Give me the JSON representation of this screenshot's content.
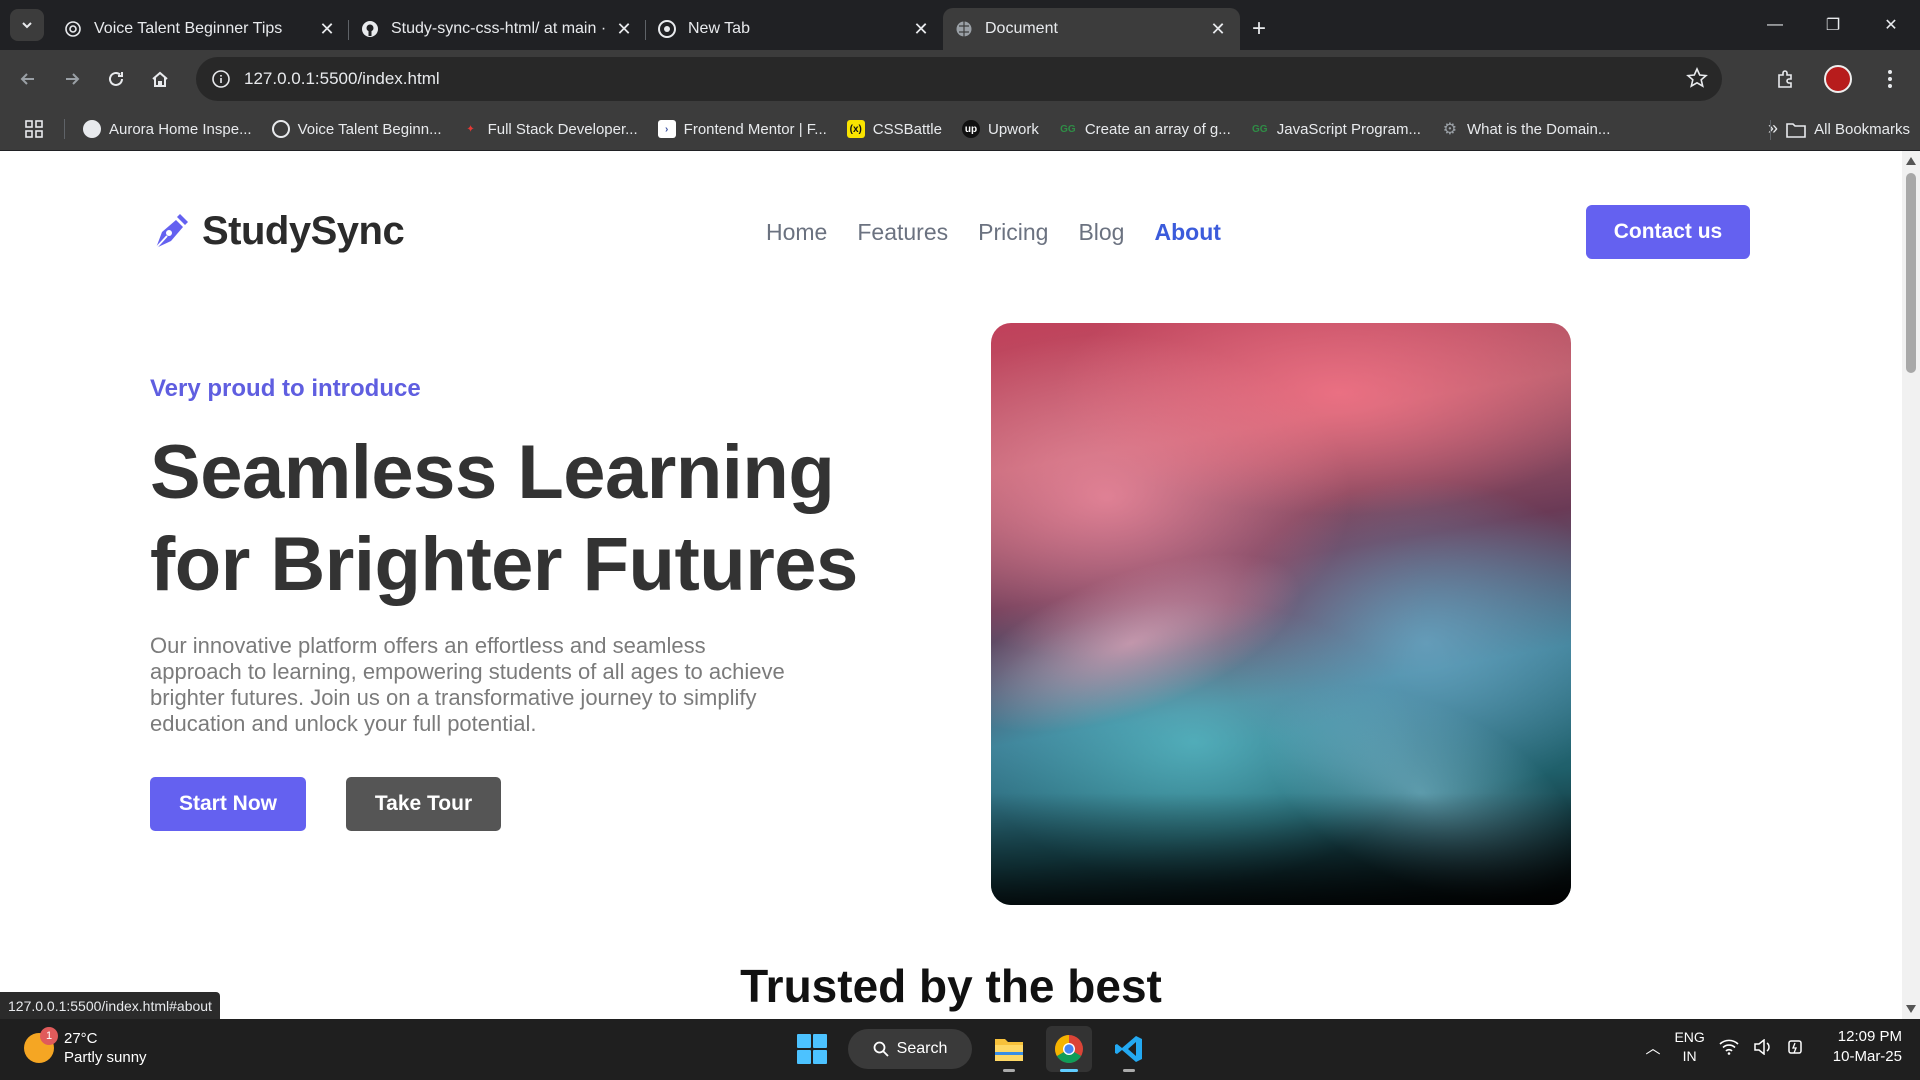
{
  "browser": {
    "tabs": [
      {
        "title": "Voice Talent Beginner Tips",
        "icon": "openai-icon"
      },
      {
        "title": "Study-sync-css-html/ at main · ",
        "icon": "github-icon"
      },
      {
        "title": "New Tab",
        "icon": "chrome-icon"
      },
      {
        "title": "Document",
        "icon": "globe-icon",
        "active": true
      }
    ],
    "address": "127.0.0.1:5500/index.html",
    "bookmarks": [
      {
        "label": "Aurora Home Inspe...",
        "icon": "globe-icon"
      },
      {
        "label": "Voice Talent Beginn...",
        "icon": "openai-icon"
      },
      {
        "label": "Full Stack Developer...",
        "icon": "red-figure-icon"
      },
      {
        "label": "Frontend Mentor | F...",
        "icon": "frontend-mentor-icon"
      },
      {
        "label": "CSSBattle",
        "icon": "cssbattle-icon"
      },
      {
        "label": "Upwork",
        "icon": "upwork-icon"
      },
      {
        "label": "Create an array of g...",
        "icon": "geeksforgeeks-icon"
      },
      {
        "label": "JavaScript Program...",
        "icon": "geeksforgeeks-icon"
      },
      {
        "label": "What is the Domain...",
        "icon": "gear-icon"
      }
    ],
    "all_bookmarks": "All Bookmarks",
    "status_url": "127.0.0.1:5500/index.html#about"
  },
  "page": {
    "logo_text": "StudySync",
    "nav": [
      "Home",
      "Features",
      "Pricing",
      "Blog",
      "About"
    ],
    "active_nav": "About",
    "contact_label": "Contact us",
    "eyebrow": "Very proud to introduce",
    "headline_line1": "Seamless Learning",
    "headline_line2": "for Brighter Futures",
    "description": "Our innovative platform offers an effortless and seamless approach to learning, empowering students of all ages to achieve brighter futures. Join us on a transformative journey to simplify education and unlock your full potential.",
    "start_label": "Start Now",
    "tour_label": "Take Tour",
    "trusted_heading": "Trusted by the best"
  },
  "taskbar": {
    "weather_temp": "27°C",
    "weather_desc": "Partly sunny",
    "weather_badge": "1",
    "search_label": "Search",
    "lang_line1": "ENG",
    "lang_line2": "IN",
    "time": "12:09 PM",
    "date": "10-Mar-25"
  },
  "colors": {
    "accent": "#6461f0",
    "active_nav": "#3b5bdb",
    "tour_button": "#555555"
  }
}
